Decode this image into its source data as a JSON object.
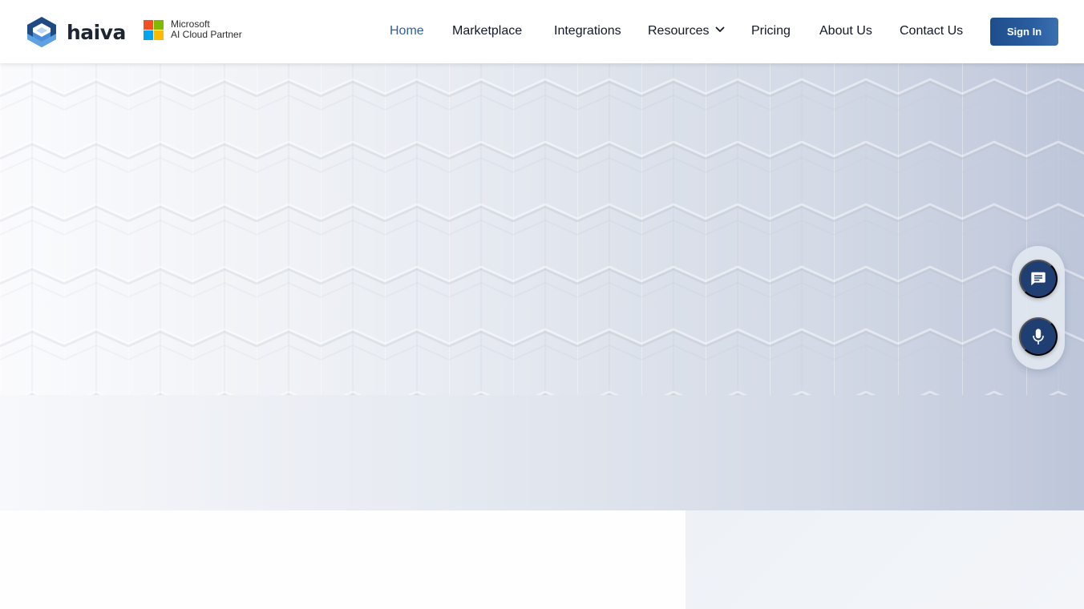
{
  "brand": {
    "name": "haiva",
    "logo_icon": "haiva-hexagon-logo",
    "accent_color": "#2e5fa0",
    "logo_colors": [
      "#1f4b84",
      "#4a8fd6",
      "#bcd6f2"
    ]
  },
  "partner_badge": {
    "icon": "microsoft-four-squares-logo",
    "line1": "Microsoft",
    "line2": "AI Cloud Partner",
    "square_colors": [
      "#f25022",
      "#7fba00",
      "#00a4ef",
      "#ffb900"
    ]
  },
  "nav": {
    "items": [
      {
        "label": "Home",
        "active": true
      },
      {
        "label": "Marketplace",
        "active": false
      },
      {
        "label": "Integrations",
        "active": false
      },
      {
        "label": "Resources",
        "active": false,
        "has_dropdown": true
      },
      {
        "label": "Pricing",
        "active": false
      },
      {
        "label": "About Us",
        "active": false
      },
      {
        "label": "Contact Us",
        "active": false
      }
    ],
    "dropdown_icon": "chevron-down-icon"
  },
  "header_actions": {
    "sign_in_label": "Sign In",
    "sign_in_color": "#1e4d8c"
  },
  "floating_widget": {
    "chat_icon": "chat-bubble-icon",
    "mic_icon": "microphone-icon",
    "button_color": "#1f3f73"
  }
}
